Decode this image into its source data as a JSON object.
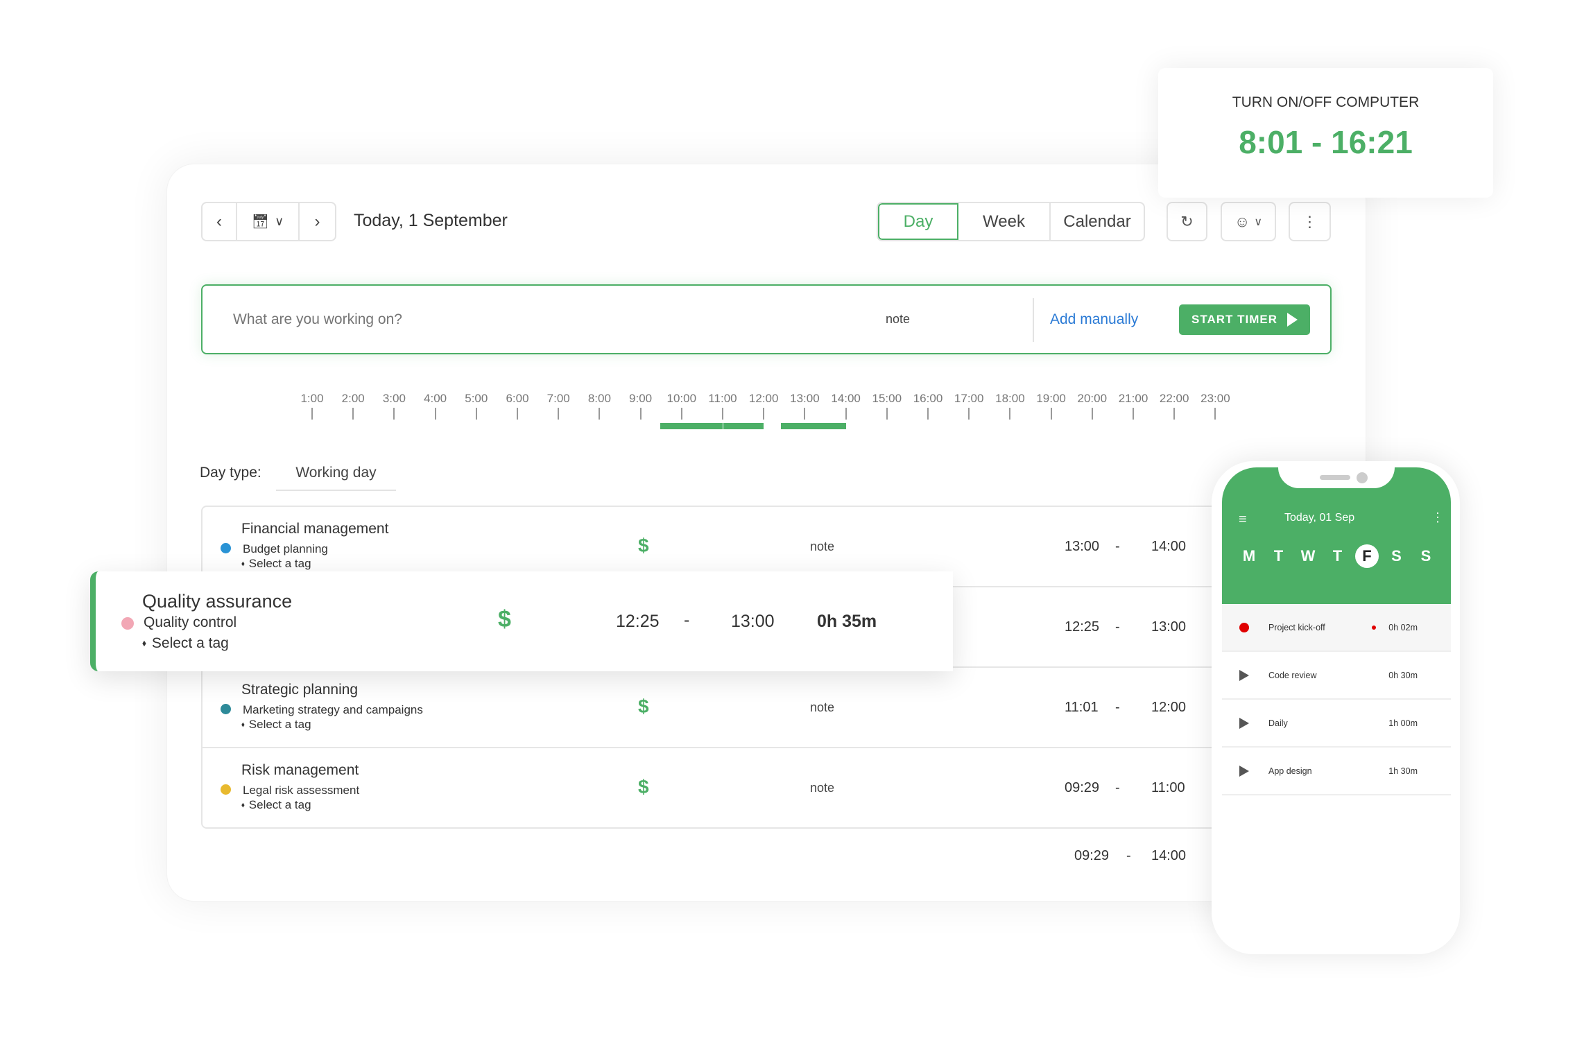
{
  "toolbar": {
    "date": "Today, 1 September",
    "tabs": [
      "Day",
      "Week",
      "Calendar"
    ],
    "active_tab": "Day"
  },
  "entry": {
    "placeholder": "What are you working on?",
    "note": "note",
    "add_manually": "Add manually",
    "start_timer": "START TIMER"
  },
  "timeline": {
    "hours": [
      "1:00",
      "2:00",
      "3:00",
      "4:00",
      "5:00",
      "6:00",
      "7:00",
      "8:00",
      "9:00",
      "10:00",
      "11:00",
      "12:00",
      "13:00",
      "14:00",
      "15:00",
      "16:00",
      "17:00",
      "18:00",
      "19:00",
      "20:00",
      "21:00",
      "22:00",
      "23:00"
    ],
    "segments": [
      [
        "09:29",
        "11:00"
      ],
      [
        "11:01",
        "12:00"
      ],
      [
        "12:25",
        "14:00"
      ]
    ]
  },
  "day_type": {
    "label": "Day type:",
    "value": "Working day"
  },
  "entries": [
    {
      "title": "Financial management",
      "subtitle": "Budget planning",
      "tag": "Select a tag",
      "dot": "#2a93d5",
      "billable": "$",
      "note": "note",
      "start": "13:00",
      "sep": "-",
      "end": "14:00"
    },
    {
      "title": "Quality assurance",
      "subtitle": "Quality control",
      "tag": "Select a tag",
      "dot": "#f2a7b5",
      "billable": "$",
      "note": "",
      "start": "12:25",
      "sep": "-",
      "end": "13:00"
    },
    {
      "title": "Strategic planning",
      "subtitle": "Marketing strategy and campaigns",
      "tag": "Select a tag",
      "dot": "#2e8a99",
      "billable": "$",
      "note": "note",
      "start": "11:01",
      "sep": "-",
      "end": "12:00"
    },
    {
      "title": "Risk management",
      "subtitle": "Legal risk assessment",
      "tag": "Select a tag",
      "dot": "#e8b92e",
      "billable": "$",
      "note": "note",
      "start": "09:29",
      "sep": "-",
      "end": "11:00"
    }
  ],
  "total": {
    "start": "09:29",
    "sep": "-",
    "end": "14:00"
  },
  "highlight": {
    "title": "Quality assurance",
    "subtitle": "Quality control",
    "tag": "Select a tag",
    "billable": "$",
    "start": "12:25",
    "sep": "-",
    "end": "13:00",
    "duration": "0h 35m"
  },
  "computer": {
    "title": "TURN ON/OFF COMPUTER",
    "range": "8:01 - 16:21"
  },
  "phone": {
    "date": "Today, 01 Sep",
    "days": [
      "M",
      "T",
      "W",
      "T",
      "F",
      "S",
      "S"
    ],
    "active_day": "F",
    "items": [
      {
        "name": "Project kick-off",
        "time": "0h 02m",
        "running": true
      },
      {
        "name": "Code review",
        "time": "0h 30m"
      },
      {
        "name": "Daily",
        "time": "1h 00m"
      },
      {
        "name": "App design",
        "time": "1h 30m"
      }
    ]
  },
  "colors": {
    "accent": "#4caf66",
    "link": "#2a7ad5",
    "recording": "#e00000"
  }
}
